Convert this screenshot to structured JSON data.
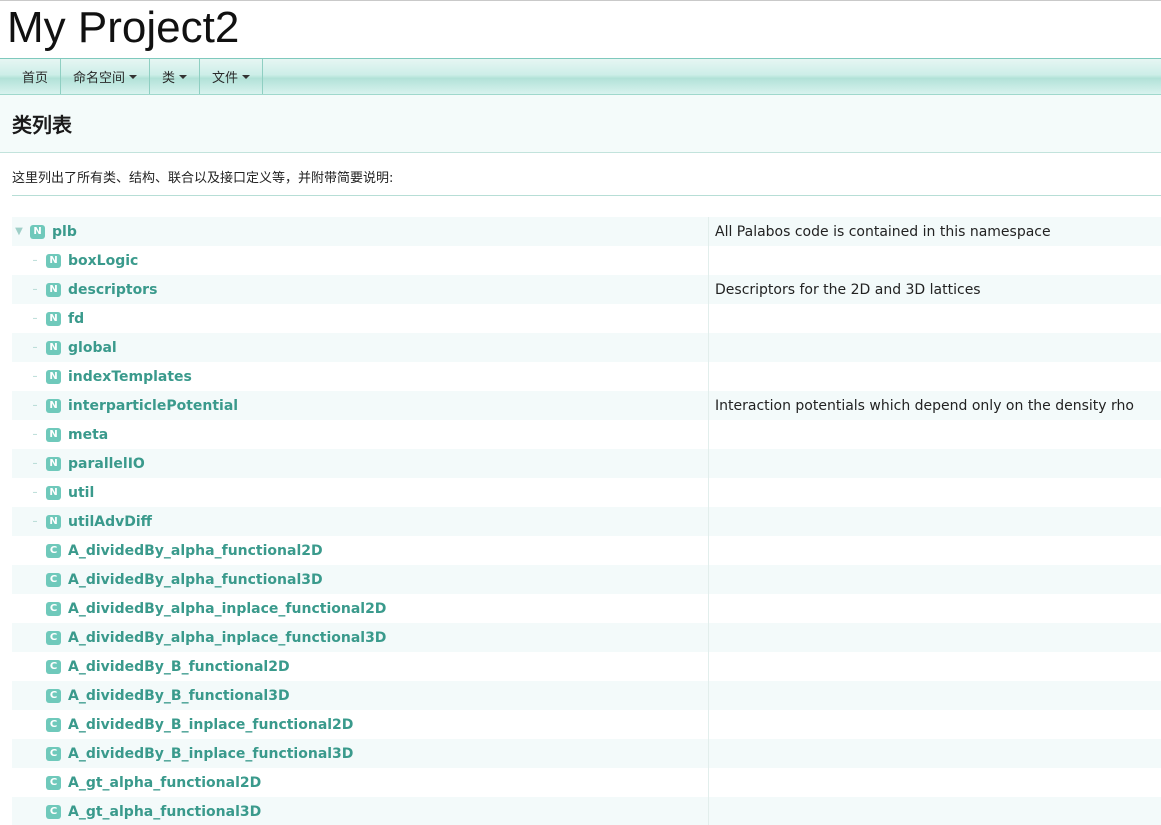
{
  "project_title": "My Project2",
  "navbar": {
    "items": [
      {
        "label": "首页",
        "has_dropdown": false
      },
      {
        "label": "命名空间",
        "has_dropdown": true
      },
      {
        "label": "类",
        "has_dropdown": true
      },
      {
        "label": "文件",
        "has_dropdown": true
      }
    ]
  },
  "page_title": "类列表",
  "description": "这里列出了所有类、结构、联合以及接口定义等，并附带简要说明:",
  "colors": {
    "accent": "#3a9a8c",
    "badge": "#6fc9bb",
    "row_alt": "#f3fafa"
  },
  "tree": [
    {
      "kind": "N",
      "name": "plb",
      "desc": "All Palabos code is contained in this namespace",
      "expanded": true
    },
    {
      "kind": "N",
      "name": "boxLogic",
      "desc": ""
    },
    {
      "kind": "N",
      "name": "descriptors",
      "desc": "Descriptors for the 2D and 3D lattices"
    },
    {
      "kind": "N",
      "name": "fd",
      "desc": ""
    },
    {
      "kind": "N",
      "name": "global",
      "desc": ""
    },
    {
      "kind": "N",
      "name": "indexTemplates",
      "desc": ""
    },
    {
      "kind": "N",
      "name": "interparticlePotential",
      "desc": "Interaction potentials which depend only on the density rho"
    },
    {
      "kind": "N",
      "name": "meta",
      "desc": ""
    },
    {
      "kind": "N",
      "name": "parallelIO",
      "desc": ""
    },
    {
      "kind": "N",
      "name": "util",
      "desc": ""
    },
    {
      "kind": "N",
      "name": "utilAdvDiff",
      "desc": ""
    },
    {
      "kind": "C",
      "name": "A_dividedBy_alpha_functional2D",
      "desc": ""
    },
    {
      "kind": "C",
      "name": "A_dividedBy_alpha_functional3D",
      "desc": ""
    },
    {
      "kind": "C",
      "name": "A_dividedBy_alpha_inplace_functional2D",
      "desc": ""
    },
    {
      "kind": "C",
      "name": "A_dividedBy_alpha_inplace_functional3D",
      "desc": ""
    },
    {
      "kind": "C",
      "name": "A_dividedBy_B_functional2D",
      "desc": ""
    },
    {
      "kind": "C",
      "name": "A_dividedBy_B_functional3D",
      "desc": ""
    },
    {
      "kind": "C",
      "name": "A_dividedBy_B_inplace_functional2D",
      "desc": ""
    },
    {
      "kind": "C",
      "name": "A_dividedBy_B_inplace_functional3D",
      "desc": ""
    },
    {
      "kind": "C",
      "name": "A_gt_alpha_functional2D",
      "desc": ""
    },
    {
      "kind": "C",
      "name": "A_gt_alpha_functional3D",
      "desc": ""
    }
  ]
}
